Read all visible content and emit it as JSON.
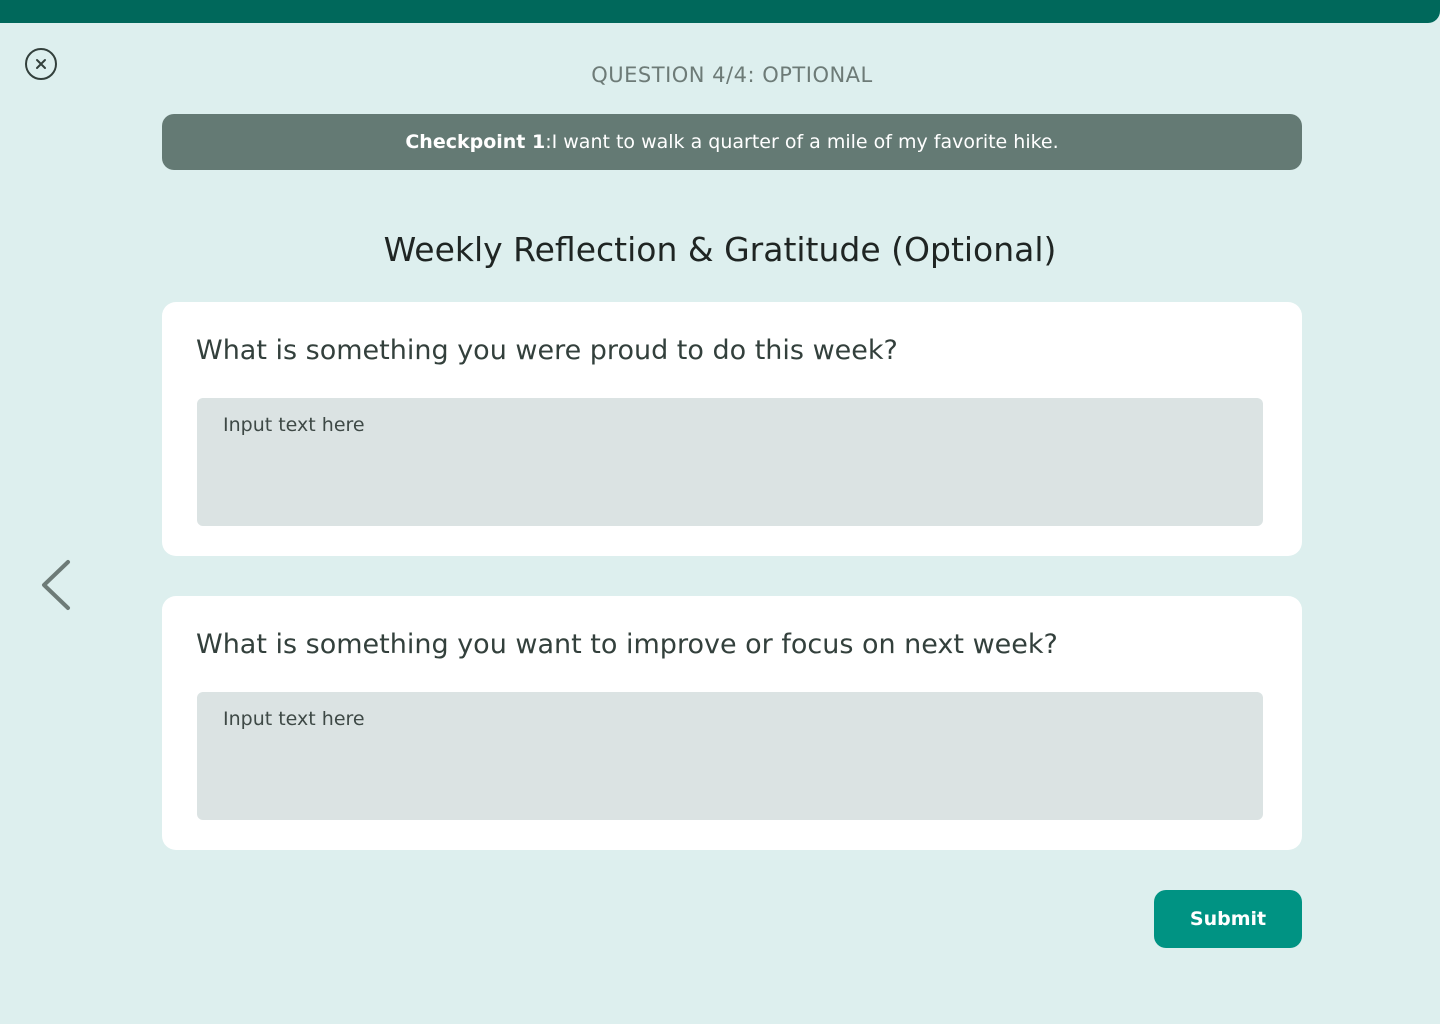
{
  "header": {
    "question_counter": "QUESTION 4/4: OPTIONAL",
    "close_icon": "close-icon"
  },
  "checkpoint": {
    "label": "Checkpoint 1",
    "separator": ":",
    "text": " I want to walk a quarter of a mile of my favorite hike."
  },
  "page": {
    "title": "Weekly Reflection & Gratitude (Optional)"
  },
  "questions": [
    {
      "prompt": "What is something you were proud to do this week?",
      "answer_value": "",
      "placeholder": "Input text here"
    },
    {
      "prompt": "What is something you want to improve or focus on next week?",
      "answer_value": "",
      "placeholder": "Input text here"
    }
  ],
  "navigation": {
    "back_icon": "chevron-left-icon"
  },
  "actions": {
    "submit_label": "Submit"
  },
  "colors": {
    "top_bar": "#00685B",
    "background": "#DDEFEE",
    "banner": "#647A74",
    "card": "#FFFFFF",
    "input_background": "#DBE3E3",
    "submit_button": "#009383",
    "text_primary": "#1F2523",
    "text_muted": "#6D7B77"
  }
}
